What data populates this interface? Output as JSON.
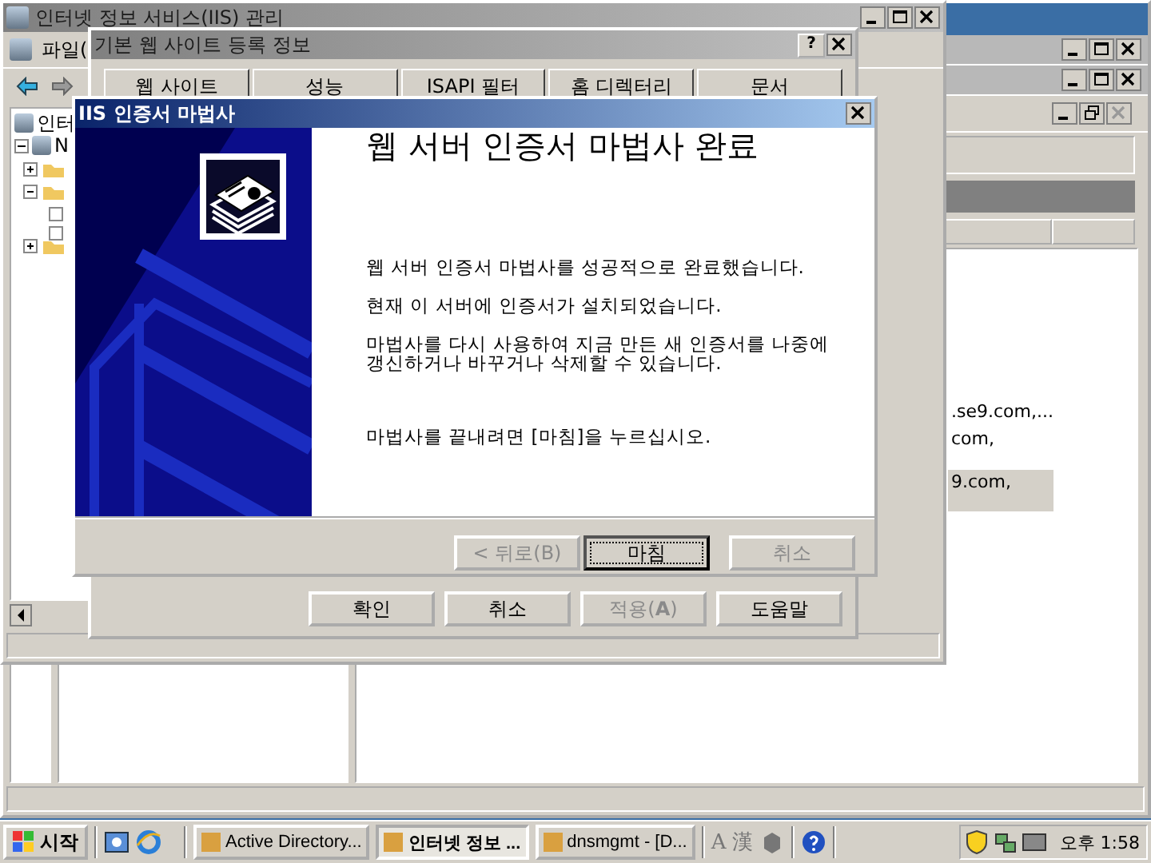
{
  "back_window": {
    "list_items": [
      {
        "label": ".se9.com,...",
        "selected": false
      },
      {
        "label": "com,",
        "selected": false
      },
      {
        "label": "9.com,",
        "selected": true
      }
    ]
  },
  "iis_window": {
    "title": "인터넷 정보 서비스(IIS) 관리",
    "menu": [
      "파일("
    ],
    "tree_root": "인터",
    "server_node": "N"
  },
  "properties_dialog": {
    "title": "기본 웹 사이트 등록 정보",
    "help_button": "?",
    "tabs": [
      {
        "label": "웹 사이트",
        "selected": false
      },
      {
        "label": "성능",
        "selected": false
      },
      {
        "label": "ISAPI 필터",
        "selected": false
      },
      {
        "label": "홈 디렉터리",
        "selected": false
      },
      {
        "label": "문서",
        "selected": false
      }
    ],
    "buttons": [
      {
        "label": "확인",
        "disabled": false
      },
      {
        "label": "취소",
        "disabled": false
      },
      {
        "label": "적용(**A**)",
        "disabled": true
      },
      {
        "label": "도움말",
        "disabled": false
      }
    ]
  },
  "wizard": {
    "title": "IIS 인증서 마법사",
    "heading": "웹 서버 인증서 마법사 완료",
    "paragraphs": [
      "웹 서버 인증서 마법사를 성공적으로 완료했습니다.",
      "현재 이 서버에 인증서가 설치되었습니다.",
      "마법사를 다시 사용하여 지금 만든 새 인증서를 나중에 갱신하거나 바꾸거나 삭제할 수 있습니다.",
      "마법사를 끝내려면 [마침]을 누르십시오."
    ],
    "buttons": [
      {
        "label": "< 뒤로(B)",
        "disabled": true,
        "focused": false
      },
      {
        "label": "마침",
        "disabled": false,
        "focused": true
      },
      {
        "label": "취소",
        "disabled": true,
        "focused": false
      }
    ]
  },
  "taskbar": {
    "start": "시작",
    "tasks": [
      {
        "label": "Active Directory...",
        "selected": false
      },
      {
        "label": "인터넷 정보 ...",
        "selected": true
      },
      {
        "label": "dnsmgmt - [D...",
        "selected": false
      }
    ],
    "ime": [
      "A",
      "漢"
    ],
    "clock": "오후 1:58"
  }
}
